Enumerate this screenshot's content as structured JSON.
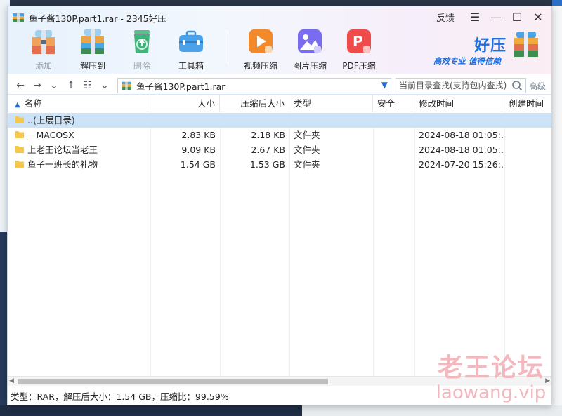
{
  "window": {
    "title": "鱼子酱130P.part1.rar - 2345好压",
    "feedback_label": "反馈"
  },
  "toolbar": [
    {
      "label": "添加",
      "icon": "add-archive-icon",
      "disabled": true
    },
    {
      "label": "解压到",
      "icon": "extract-to-icon",
      "disabled": false
    },
    {
      "label": "删除",
      "icon": "recycle-bin-icon",
      "disabled": true
    },
    {
      "label": "工具箱",
      "icon": "toolbox-icon",
      "disabled": false
    },
    {
      "label": "视频压缩",
      "icon": "video-compress-icon",
      "disabled": false
    },
    {
      "label": "图片压缩",
      "icon": "image-compress-icon",
      "disabled": false
    },
    {
      "label": "PDF压缩",
      "icon": "pdf-compress-icon",
      "disabled": false
    }
  ],
  "brand": {
    "name": "好压",
    "slogan": "高效专业  值得信赖"
  },
  "address": {
    "path": "鱼子酱130P.part1.rar",
    "search_placeholder": "当前目录查找(支持包内查找)",
    "advanced_label": "高级"
  },
  "columns": [
    "名称",
    "大小",
    "压缩后大小",
    "类型",
    "安全",
    "修改时间",
    "创建时间"
  ],
  "rows": [
    {
      "name": "..(上层目录)",
      "size": "",
      "packed": "",
      "type": "",
      "security": "",
      "modified": "",
      "selected": true
    },
    {
      "name": "__MACOSX",
      "size": "2.83 KB",
      "packed": "2.18 KB",
      "type": "文件夹",
      "security": "",
      "modified": "2024-08-18 01:05:...",
      "selected": false
    },
    {
      "name": "上老王论坛当老王",
      "size": "9.09 KB",
      "packed": "2.67 KB",
      "type": "文件夹",
      "security": "",
      "modified": "2024-08-18 01:05:...",
      "selected": false
    },
    {
      "name": "鱼子一班长的礼物",
      "size": "1.54 GB",
      "packed": "1.53 GB",
      "type": "文件夹",
      "security": "",
      "modified": "2024-07-20 15:26:...",
      "selected": false
    }
  ],
  "status": "类型：RAR，解压后大小：1.54 GB，压缩比：99.59%",
  "watermark": {
    "line1": "老王论坛",
    "line2": "laowang.vip"
  },
  "colors": {
    "accent": "#1d6fe0",
    "selection": "#cde3f7",
    "folder": "#f5c84c"
  }
}
